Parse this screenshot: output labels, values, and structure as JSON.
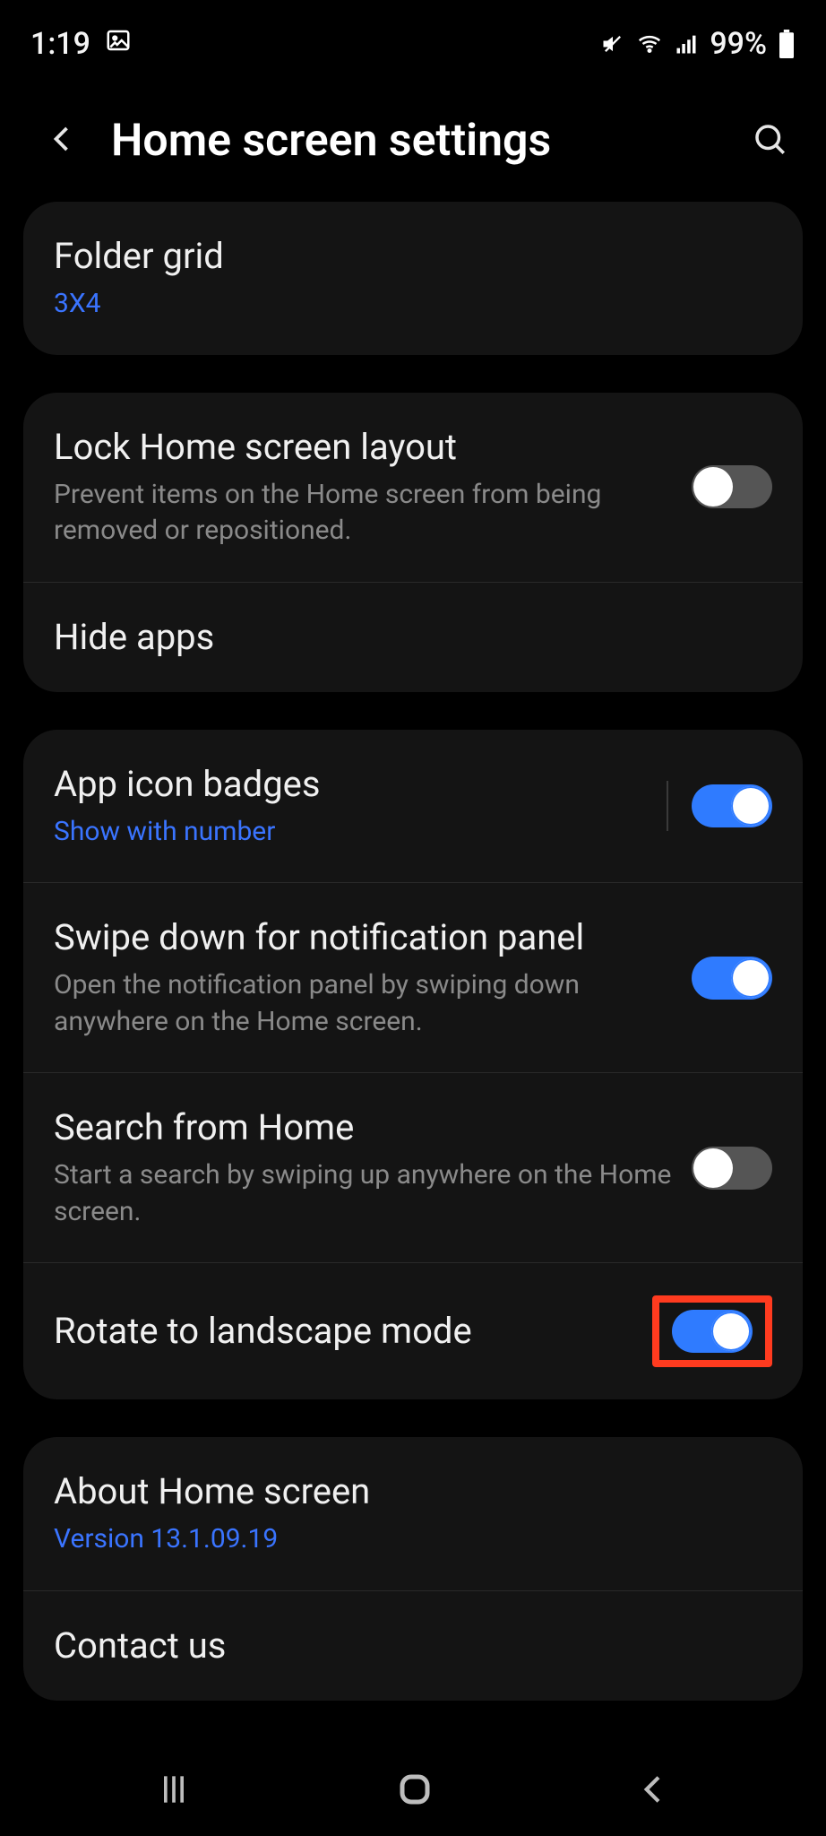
{
  "status": {
    "time": "1:19",
    "battery": "99%"
  },
  "header": {
    "title": "Home screen settings"
  },
  "group1": {
    "folder_grid": {
      "title": "Folder grid",
      "value": "3X4"
    }
  },
  "group2": {
    "lock_layout": {
      "title": "Lock Home screen layout",
      "desc": "Prevent items on the Home screen from being removed or repositioned."
    },
    "hide_apps": {
      "title": "Hide apps"
    }
  },
  "group3": {
    "badges": {
      "title": "App icon badges",
      "sub": "Show with number"
    },
    "swipe_down": {
      "title": "Swipe down for notification panel",
      "desc": "Open the notification panel by swiping down anywhere on the Home screen."
    },
    "search_home": {
      "title": "Search from Home",
      "desc": "Start a search by swiping up anywhere on the Home screen."
    },
    "rotate": {
      "title": "Rotate to landscape mode"
    }
  },
  "group4": {
    "about": {
      "title": "About Home screen",
      "version": "Version 13.1.09.19"
    },
    "contact": {
      "title": "Contact us"
    }
  }
}
